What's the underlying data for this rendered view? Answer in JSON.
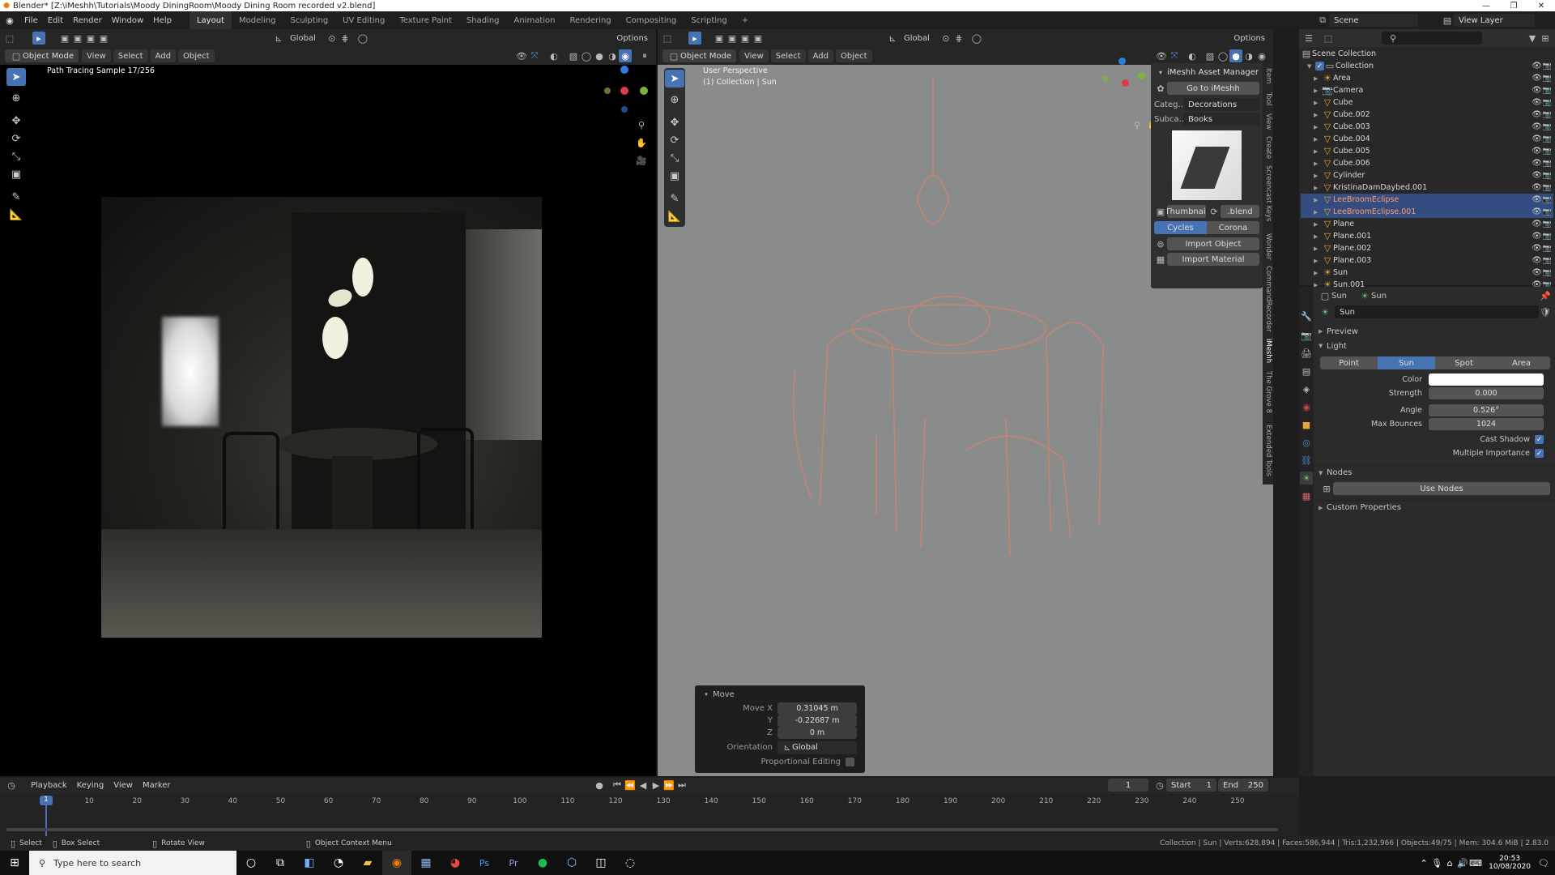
{
  "title_bar": {
    "text": "Blender* [Z:\\iMeshh\\Tutorials\\Moody DiningRoom\\Moody Dining Room recorded v2.blend]"
  },
  "menus": [
    "File",
    "Edit",
    "Render",
    "Window",
    "Help"
  ],
  "workspaces": [
    "Layout",
    "Modeling",
    "Sculpting",
    "UV Editing",
    "Texture Paint",
    "Shading",
    "Animation",
    "Rendering",
    "Compositing",
    "Scripting"
  ],
  "active_workspace": "Layout",
  "scene": {
    "label": "Scene",
    "view_layer": "View Layer"
  },
  "left_viewport": {
    "options": "Options",
    "orientation": "Global",
    "mode": "Object Mode",
    "menus": [
      "View",
      "Select",
      "Add",
      "Object"
    ],
    "overlay_text": "Path Tracing Sample 17/256"
  },
  "right_viewport": {
    "options": "Options",
    "orientation": "Global",
    "mode": "Object Mode",
    "menus": [
      "View",
      "Select",
      "Add",
      "Object"
    ],
    "perspective": "User Perspective",
    "collection_info": "(1) Collection | Sun"
  },
  "imeshh": {
    "title": "iMeshh Asset Manager",
    "goto": "Go to iMeshh",
    "category_label": "Categ...",
    "category": "Decorations",
    "subcategory_label": "Subca...",
    "subcategory": "Books",
    "thumbnail_label": "Thumbnail",
    "blend_label": ".blend",
    "engine_cycles": "Cycles",
    "engine_corona": "Corona",
    "import_object": "Import Object",
    "import_material": "Import Material"
  },
  "sidebar_tabs": [
    "Item",
    "Tool",
    "View",
    "Create",
    "Screencast Keys",
    "Wonder",
    "CommandRecorder",
    "iMeshh",
    "The Grove 8",
    "Extended Tools"
  ],
  "move_panel": {
    "title": "Move",
    "x_label": "Move X",
    "x": "0.31045 m",
    "y_label": "Y",
    "y": "-0.22687 m",
    "z_label": "Z",
    "z": "0 m",
    "orientation_label": "Orientation",
    "orientation": "Global",
    "proportional_label": "Proportional Editing"
  },
  "outliner": {
    "root": "Scene Collection",
    "collection": "Collection",
    "items": [
      {
        "name": "Area",
        "type": "light",
        "selected": false
      },
      {
        "name": "Camera",
        "type": "camera",
        "selected": false
      },
      {
        "name": "Cube",
        "type": "mesh",
        "selected": false
      },
      {
        "name": "Cube.002",
        "type": "mesh",
        "selected": false
      },
      {
        "name": "Cube.003",
        "type": "mesh",
        "selected": false
      },
      {
        "name": "Cube.004",
        "type": "mesh",
        "selected": false
      },
      {
        "name": "Cube.005",
        "type": "mesh",
        "selected": false
      },
      {
        "name": "Cube.006",
        "type": "mesh",
        "selected": false
      },
      {
        "name": "Cylinder",
        "type": "mesh",
        "selected": false
      },
      {
        "name": "KristinaDamDaybed.001",
        "type": "mesh",
        "selected": false
      },
      {
        "name": "LeeBroomEclipse",
        "type": "mesh",
        "selected": true
      },
      {
        "name": "LeeBroomEclipse.001",
        "type": "mesh",
        "selected": true
      },
      {
        "name": "Plane",
        "type": "mesh",
        "selected": false
      },
      {
        "name": "Plane.001",
        "type": "mesh",
        "selected": false
      },
      {
        "name": "Plane.002",
        "type": "mesh",
        "selected": false
      },
      {
        "name": "Plane.003",
        "type": "mesh",
        "selected": false
      },
      {
        "name": "Sun",
        "type": "light",
        "selected": false
      },
      {
        "name": "Sun.001",
        "type": "light",
        "selected": false
      }
    ]
  },
  "properties": {
    "breadcrumb_object": "Sun",
    "breadcrumb_data": "Sun",
    "datablock": "Sun",
    "preview": "Preview",
    "light": "Light",
    "light_types": [
      "Point",
      "Sun",
      "Spot",
      "Area"
    ],
    "active_light_type": "Sun",
    "color_label": "Color",
    "strength_label": "Strength",
    "strength": "0.000",
    "angle_label": "Angle",
    "angle": "0.526°",
    "bounces_label": "Max Bounces",
    "bounces": "1024",
    "cast_shadow": "Cast Shadow",
    "multiple_importance": "Multiple Importance",
    "nodes": "Nodes",
    "use_nodes": "Use Nodes",
    "custom_properties": "Custom Properties"
  },
  "timeline": {
    "menus": [
      "Playback",
      "Keying",
      "View",
      "Marker"
    ],
    "current_frame": "1",
    "start_label": "Start",
    "start": "1",
    "end_label": "End",
    "end": "250",
    "ticks": [
      "1",
      "10",
      "20",
      "30",
      "40",
      "50",
      "60",
      "70",
      "80",
      "90",
      "100",
      "110",
      "120",
      "130",
      "140",
      "150",
      "160",
      "170",
      "180",
      "190",
      "200",
      "210",
      "220",
      "230",
      "240",
      "250"
    ]
  },
  "statusbar": {
    "select": "Select",
    "box_select": "Box Select",
    "rotate_view": "Rotate View",
    "context_menu": "Object Context Menu",
    "stats": "Collection | Sun | Verts:628,894 | Faces:586,944 | Tris:1,232,966 | Objects:49/75 | Mem: 304.6 MiB | 2.83.0"
  },
  "taskbar": {
    "search_placeholder": "Type here to search",
    "time": "20:53",
    "date": "10/08/2020"
  },
  "colors": {
    "accent": "#4772b3",
    "selected_text": "#ff9a6e",
    "viewport_grey": "#8a8c8c"
  }
}
